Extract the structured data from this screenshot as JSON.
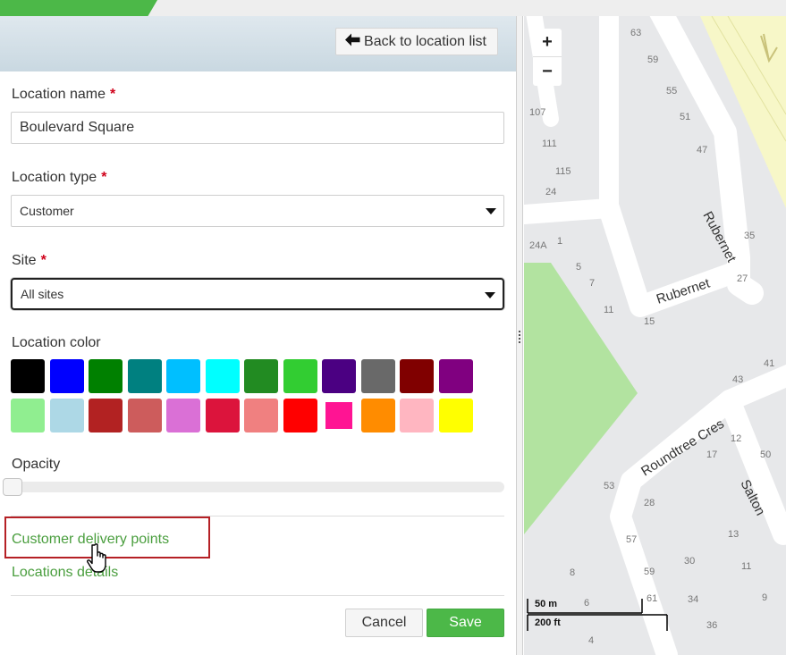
{
  "panel": {
    "back_button_label": "Back to location list",
    "location_name": {
      "label": "Location name",
      "required_mark": "*",
      "value": "Boulevard Square"
    },
    "location_type": {
      "label": "Location type",
      "required_mark": "*",
      "value": "Customer"
    },
    "site": {
      "label": "Site",
      "required_mark": "*",
      "value": "All sites"
    },
    "location_color": {
      "label": "Location color",
      "swatches_row1": [
        "#000000",
        "#0000ff",
        "#008000",
        "#008080",
        "#00bfff",
        "#00ffff",
        "#228b22",
        "#32cd32",
        "#4b0082",
        "#696969",
        "#800000",
        "#800080"
      ],
      "swatches_row2": [
        "#90ee90",
        "#add8e6",
        "#b22222",
        "#cd5c5c",
        "#da70d6",
        "#dc143c",
        "#f08080",
        "#ff0000",
        "#ff1493",
        "#ff8c00",
        "#ffb6c1",
        "#ffff00"
      ],
      "selected_color": "#ff1493"
    },
    "opacity": {
      "label": "Opacity",
      "value": 0
    },
    "links": {
      "delivery_points": "Customer delivery points",
      "location_details": "Locations details"
    },
    "actions": {
      "cancel": "Cancel",
      "save": "Save"
    }
  },
  "map": {
    "zoom_in": "+",
    "zoom_out": "−",
    "scale_metric": "50 m",
    "scale_imperial": "200 ft",
    "street_labels": [
      "Rubernet",
      "Rubernet",
      "Roundtree Cres",
      "Salton"
    ],
    "house_numbers": [
      "63",
      "59",
      "55",
      "51",
      "47",
      "35",
      "27",
      "107",
      "111",
      "115",
      "24",
      "24A",
      "1",
      "5",
      "7",
      "11",
      "15",
      "43",
      "41",
      "12",
      "17",
      "50",
      "53",
      "28",
      "13",
      "57",
      "30",
      "11",
      "8",
      "59",
      "6",
      "61",
      "34",
      "9",
      "36",
      "4"
    ]
  }
}
